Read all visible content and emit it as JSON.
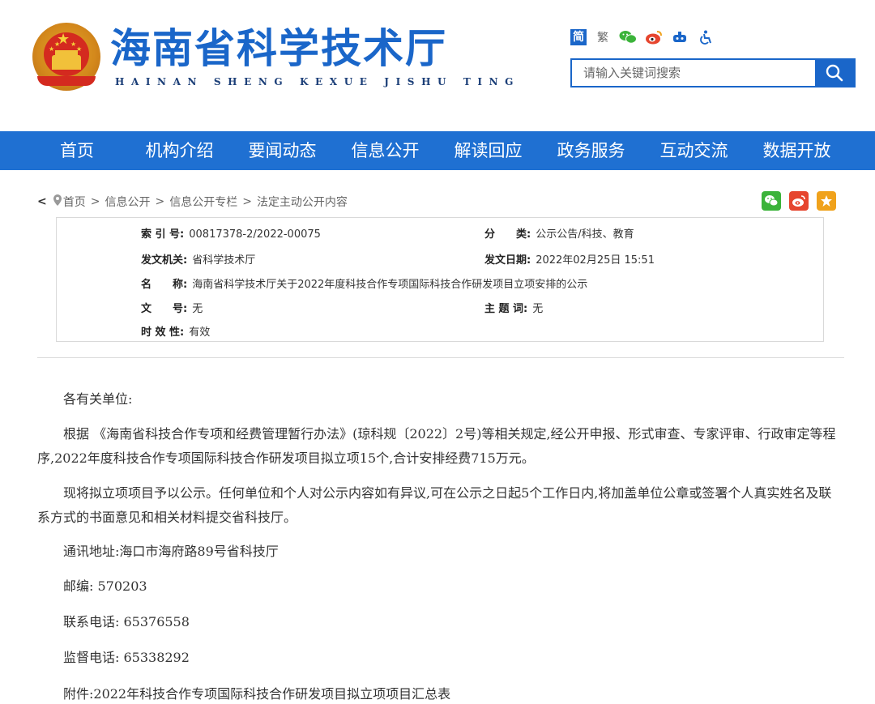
{
  "header": {
    "title": "海南省科学技术厅",
    "pinyin": "HAINAN SHENG KEXUE JISHU TING",
    "tools": {
      "simplified": "简",
      "traditional": "繁",
      "icons": [
        "wechat-icon",
        "weibo-icon",
        "robot-icon",
        "accessibility-icon"
      ]
    },
    "search": {
      "placeholder": "请输入关键词搜索"
    }
  },
  "nav": {
    "items": [
      "首页",
      "机构介绍",
      "要闻动态",
      "信息公开",
      "解读回应",
      "政务服务",
      "互动交流",
      "数据开放"
    ]
  },
  "breadcrumb": {
    "back": "<",
    "items": [
      "首页",
      "信息公开",
      "信息公开专栏",
      "法定主动公开内容"
    ],
    "separator": ">"
  },
  "meta": {
    "index_label": "索 引 号:",
    "index_value": "00817378-2/2022-00075",
    "category_label": "分　　类:",
    "category_value": "公示公告/科技、教育",
    "issuer_label": "发文机关:",
    "issuer_value": "省科学技术厅",
    "date_label": "发文日期:",
    "date_value": "2022年02月25日 15:51",
    "name_label": "名　　称:",
    "name_value": "海南省科学技术厅关于2022年度科技合作专项国际科技合作研发项目立项安排的公示",
    "docno_label": "文　　号:",
    "docno_value": "无",
    "subject_label": "主 题 词:",
    "subject_value": "无",
    "validity_label": "时 效 性:",
    "validity_value": "有效"
  },
  "content": {
    "greeting": "各有关单位:",
    "para1": "根据 《海南省科技合作专项和经费管理暂行办法》(琼科规〔2022〕2号)等相关规定,经公开申报、形式审查、专家评审、行政审定等程序,2022年度科技合作专项国际科技合作研发项目拟立项15个,合计安排经费715万元。",
    "para2": "现将拟立项项目予以公示。任何单位和个人对公示内容如有异议,可在公示之日起5个工作日内,将加盖单位公章或签署个人真实姓名及联系方式的书面意见和相关材料提交省科技厅。",
    "address": "通讯地址:海口市海府路89号省科技厅",
    "postcode": "邮编: 570203",
    "contact_phone": "联系电话: 65376558",
    "supervise_phone": "监督电话: 65338292",
    "attachment": "附件:2022年科技合作专项国际科技合作研发项目拟立项项目汇总表"
  },
  "colors": {
    "brand_blue": "#1a66c9",
    "nav_blue": "#1f70d2",
    "emblem_red": "#d42a1f",
    "emblem_gold": "#d4891c"
  }
}
